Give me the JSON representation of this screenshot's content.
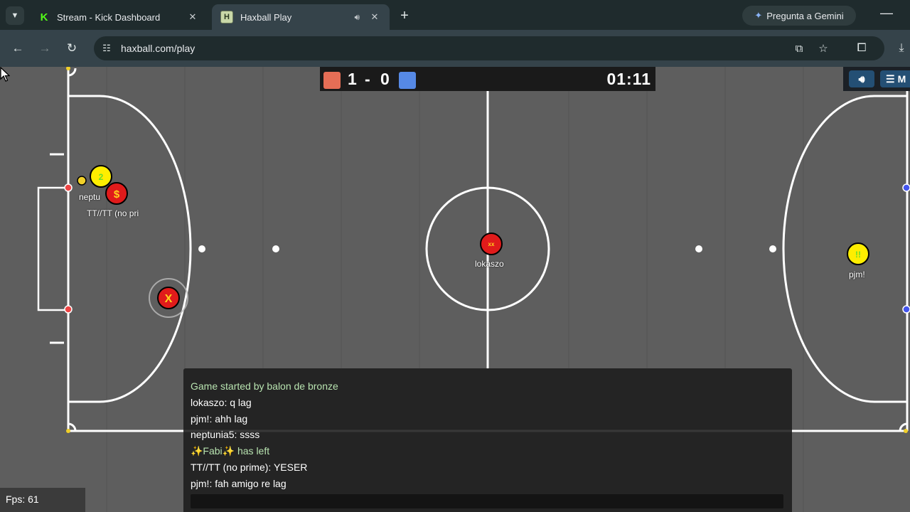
{
  "browser": {
    "tabs": [
      {
        "title": "Stream - Kick Dashboard",
        "favicon": "kick-icon",
        "active": false
      },
      {
        "title": "Haxball Play",
        "favicon": "haxball-icon",
        "active": true
      }
    ],
    "gemini_label": "Pregunta a Gemini",
    "url": "haxball.com/play"
  },
  "game": {
    "score": {
      "red": "1",
      "separator": "-",
      "blue": "0"
    },
    "timer": "01:11",
    "menu_label": "M",
    "colors": {
      "red_team": "#e56e56",
      "blue_team": "#5689e5",
      "red_player": "#e01b1b",
      "yellow_player": "#ffee00",
      "pitch": "#5e5e5e"
    },
    "players": [
      {
        "team": "red",
        "avatar": "xx",
        "name": "lokaszo"
      },
      {
        "team": "red",
        "avatar": "$",
        "name": "neptunia5"
      },
      {
        "team": "red",
        "avatar": "X",
        "name": ""
      },
      {
        "team": "yellow",
        "avatar": "2",
        "name": "TT//TT (no prime)"
      },
      {
        "team": "yellow",
        "avatar": "!!",
        "name": "pjm!"
      }
    ],
    "name_labels": {
      "neptunia": "neptu",
      "tt": "TT//TT (no pri",
      "lokaszo": "lokaszo",
      "pjm": "pjm!"
    }
  },
  "chat": {
    "messages": [
      {
        "text": "Game started by balon de bronze",
        "type": "notice"
      },
      {
        "text": "lokaszo: q lag",
        "type": "message"
      },
      {
        "text": "pjm!: ahh lag",
        "type": "message"
      },
      {
        "text": "neptunia5: ssss",
        "type": "message"
      },
      {
        "text": "✨Fabi✨ has left",
        "type": "notice"
      },
      {
        "text": "TT//TT (no prime): YESER",
        "type": "message"
      },
      {
        "text": "pjm!: fah amigo re lag",
        "type": "message"
      }
    ],
    "input_value": ""
  },
  "fps": "Fps: 61"
}
